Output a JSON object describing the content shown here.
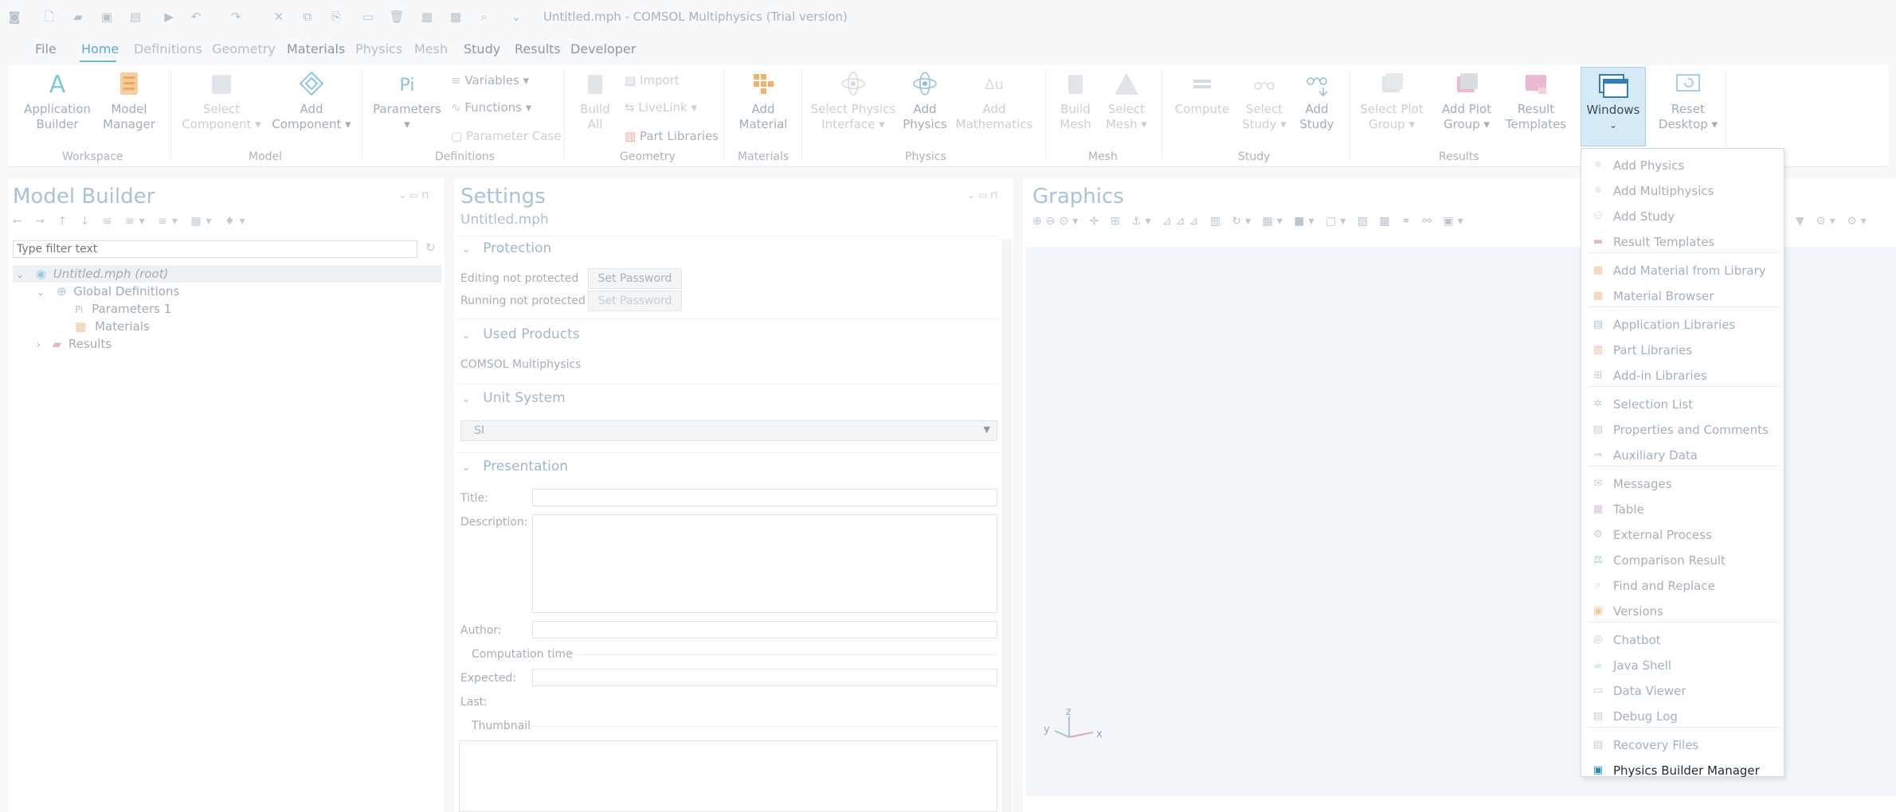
{
  "window": {
    "title": "Untitled.mph - COMSOL Multiphysics (Trial version)"
  },
  "menu": {
    "file": "File",
    "tabs": [
      "Home",
      "Definitions",
      "Geometry",
      "Materials",
      "Physics",
      "Mesh",
      "Study",
      "Results",
      "Developer"
    ]
  },
  "ribbon": {
    "workspace": {
      "group": "Workspace",
      "app_builder": [
        "Application",
        "Builder"
      ],
      "model_manager": [
        "Model",
        "Manager"
      ]
    },
    "model": {
      "group": "Model",
      "select_component": [
        "Select",
        "Component"
      ],
      "add_component": [
        "Add",
        "Component"
      ]
    },
    "definitions": {
      "group": "Definitions",
      "parameters": "Parameters",
      "variables": "Variables",
      "functions": "Functions",
      "parameter_case": "Parameter Case",
      "parameters_glyph": "Pi"
    },
    "geometry": {
      "group": "Geometry",
      "build_all": [
        "Build",
        "All"
      ],
      "import": "Import",
      "livelink": "LiveLink",
      "part_libraries": "Part Libraries"
    },
    "materials": {
      "group": "Materials",
      "add_material": [
        "Add",
        "Material"
      ]
    },
    "physics": {
      "group": "Physics",
      "select_physics": [
        "Select Physics",
        "Interface"
      ],
      "add_physics": [
        "Add",
        "Physics"
      ],
      "add_mathematics": [
        "Add",
        "Mathematics"
      ]
    },
    "mesh": {
      "group": "Mesh",
      "build_mesh": [
        "Build",
        "Mesh"
      ],
      "select_mesh": [
        "Select",
        "Mesh"
      ]
    },
    "study": {
      "group": "Study",
      "compute": "Compute",
      "select_study": [
        "Select",
        "Study"
      ],
      "add_study": [
        "Add",
        "Study"
      ]
    },
    "results": {
      "group": "Results",
      "select_plot": [
        "Select Plot",
        "Group"
      ],
      "add_plot": [
        "Add Plot",
        "Group"
      ],
      "result_templates": [
        "Result",
        "Templates"
      ]
    },
    "windows": {
      "label": "Windows"
    },
    "reset_desktop": [
      "Reset",
      "Desktop"
    ]
  },
  "model_builder": {
    "title": "Model Builder",
    "filter_placeholder": "Type filter text",
    "tree": {
      "root": "Untitled.mph (root)",
      "global_definitions": "Global Definitions",
      "parameters": "Parameters 1",
      "materials": "Materials",
      "results": "Results"
    }
  },
  "settings": {
    "title": "Settings",
    "subtitle": "Untitled.mph",
    "protection": {
      "header": "Protection",
      "editing": "Editing not protected",
      "running": "Running not protected",
      "set_password": "Set Password"
    },
    "used_products": {
      "header": "Used Products",
      "item": "COMSOL Multiphysics"
    },
    "unit_system": {
      "header": "Unit System",
      "value": "SI"
    },
    "presentation": {
      "header": "Presentation",
      "title_label": "Title:",
      "description_label": "Description:",
      "author_label": "Author:",
      "computation_time": "Computation time",
      "expected_label": "Expected:",
      "last_label": "Last:",
      "thumbnail": "Thumbnail"
    }
  },
  "graphics": {
    "title": "Graphics",
    "axes": {
      "x": "x",
      "y": "y",
      "z": "z"
    }
  },
  "windows_menu": {
    "items": [
      {
        "label": "Add Physics",
        "icon": "add-physics-icon",
        "color": "#c7cdd4"
      },
      {
        "label": "Add Multiphysics",
        "icon": "add-multiphysics-icon",
        "color": "#c7cdd4"
      },
      {
        "label": "Add Study",
        "icon": "add-study-icon",
        "color": "#c7cdd4"
      },
      {
        "label": "Result Templates",
        "icon": "result-templates-icon",
        "color": "#e7b7cf"
      },
      {
        "label": "Add Material from Library",
        "icon": "add-material-icon",
        "color": "#f2c79c"
      },
      {
        "label": "Material Browser",
        "icon": "material-browser-icon",
        "color": "#f2c79c"
      },
      {
        "label": "Application Libraries",
        "icon": "application-libraries-icon",
        "color": "#b9c6d3"
      },
      {
        "label": "Part Libraries",
        "icon": "part-libraries-icon",
        "color": "#f0b6a8"
      },
      {
        "label": "Add-in Libraries",
        "icon": "addin-libraries-icon",
        "color": "#c7cdd4"
      },
      {
        "label": "Selection List",
        "icon": "selection-list-icon",
        "color": "#b6cfe6"
      },
      {
        "label": "Properties and Comments",
        "icon": "properties-icon",
        "color": "#c7cdd4"
      },
      {
        "label": "Auxiliary Data",
        "icon": "auxiliary-data-icon",
        "color": "#f2c79c"
      },
      {
        "label": "Messages",
        "icon": "messages-icon",
        "color": "#c7cdd4"
      },
      {
        "label": "Table",
        "icon": "table-icon",
        "color": "#e2c0dc"
      },
      {
        "label": "External Process",
        "icon": "external-process-icon",
        "color": "#c7cdd4"
      },
      {
        "label": "Comparison Result",
        "icon": "comparison-result-icon",
        "color": "#9cc5e8"
      },
      {
        "label": "Find and Replace",
        "icon": "find-replace-icon",
        "color": "#c7cdd4"
      },
      {
        "label": "Versions",
        "icon": "versions-icon",
        "color": "#f2c79c"
      },
      {
        "label": "Chatbot",
        "icon": "chatbot-icon",
        "color": "#c7cdd4"
      },
      {
        "label": "Java Shell",
        "icon": "java-shell-icon",
        "color": "#a8d1b8"
      },
      {
        "label": "Data Viewer",
        "icon": "data-viewer-icon",
        "color": "#c7cdd4"
      },
      {
        "label": "Debug Log",
        "icon": "debug-log-icon",
        "color": "#c7cdd4"
      },
      {
        "label": "Recovery Files",
        "icon": "recovery-files-icon",
        "color": "#c7cdd4"
      },
      {
        "label": "Physics Builder Manager",
        "icon": "physics-builder-icon",
        "color": "#1f8fb8"
      }
    ]
  }
}
